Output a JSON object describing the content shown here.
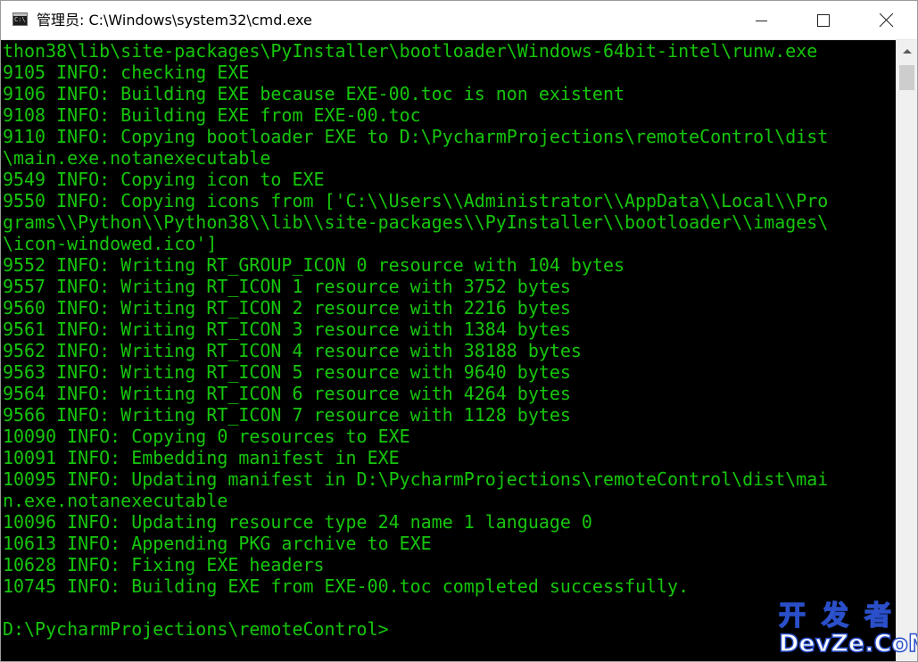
{
  "window": {
    "title": "管理员: C:\\Windows\\system32\\cmd.exe",
    "icon": "cmd-console-icon",
    "icon_label": "C:\\"
  },
  "colors": {
    "console_text": "#16c60c",
    "console_bg": "#000000",
    "watermark": "#2a4fc9"
  },
  "console": {
    "lines": [
      "thon38\\lib\\site-packages\\PyInstaller\\bootloader\\Windows-64bit-intel\\runw.exe",
      "9105 INFO: checking EXE",
      "9106 INFO: Building EXE because EXE-00.toc is non existent",
      "9108 INFO: Building EXE from EXE-00.toc",
      "9110 INFO: Copying bootloader EXE to D:\\PycharmProjections\\remoteControl\\dist",
      "\\main.exe.notanexecutable",
      "9549 INFO: Copying icon to EXE",
      "9550 INFO: Copying icons from ['C:\\\\Users\\\\Administrator\\\\AppData\\\\Local\\\\Pro",
      "grams\\\\Python\\\\Python38\\\\lib\\\\site-packages\\\\PyInstaller\\\\bootloader\\\\images\\",
      "\\icon-windowed.ico']",
      "9552 INFO: Writing RT_GROUP_ICON 0 resource with 104 bytes",
      "9557 INFO: Writing RT_ICON 1 resource with 3752 bytes",
      "9560 INFO: Writing RT_ICON 2 resource with 2216 bytes",
      "9561 INFO: Writing RT_ICON 3 resource with 1384 bytes",
      "9562 INFO: Writing RT_ICON 4 resource with 38188 bytes",
      "9563 INFO: Writing RT_ICON 5 resource with 9640 bytes",
      "9564 INFO: Writing RT_ICON 6 resource with 4264 bytes",
      "9566 INFO: Writing RT_ICON 7 resource with 1128 bytes",
      "10090 INFO: Copying 0 resources to EXE",
      "10091 INFO: Embedding manifest in EXE",
      "10095 INFO: Updating manifest in D:\\PycharmProjections\\remoteControl\\dist\\mai",
      "n.exe.notanexecutable",
      "10096 INFO: Updating resource type 24 name 1 language 0",
      "10613 INFO: Appending PKG archive to EXE",
      "10628 INFO: Fixing EXE headers",
      "10745 INFO: Building EXE from EXE-00.toc completed successfully.",
      "",
      "D:\\PycharmProjections\\remoteControl>"
    ]
  },
  "watermark": {
    "top": "开发者",
    "bottom": "DevZe.CoM"
  }
}
